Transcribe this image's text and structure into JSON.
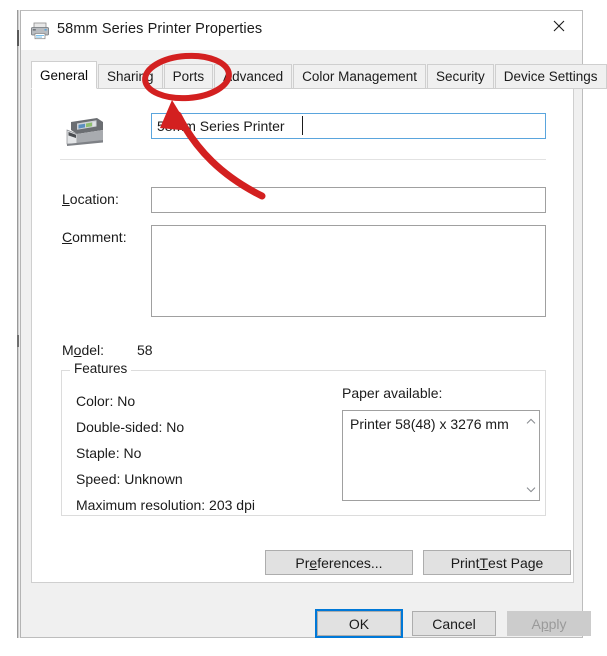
{
  "window": {
    "title": "58mm Series Printer Properties",
    "title_icon": "printer-icon",
    "close_icon": "close-icon"
  },
  "tabs": [
    {
      "label": "General",
      "active": true
    },
    {
      "label": "Sharing",
      "active": false
    },
    {
      "label": "Ports",
      "active": false
    },
    {
      "label": "Advanced",
      "active": false
    },
    {
      "label": "Color Management",
      "active": false
    },
    {
      "label": "Security",
      "active": false
    },
    {
      "label": "Device Settings",
      "active": false
    }
  ],
  "general": {
    "device_icon": "printer-device-icon",
    "name_value": "58mm Series Printer",
    "name_placeholder": "",
    "location_label_pre": "",
    "location_label_mnemonic": "L",
    "location_label_post": "ocation:",
    "location_value": "",
    "location_placeholder": "",
    "comment_label_mnemonic": "C",
    "comment_label_post": "omment:",
    "comment_value": "",
    "comment_placeholder": "",
    "model_label_pre": "M",
    "model_label_mnemonic": "o",
    "model_label_post": "del:",
    "model_value": "58",
    "features_group_title": "Features",
    "features": [
      "Color: No",
      "Double-sided: No",
      "Staple: No",
      "Speed: Unknown",
      "Maximum resolution: 203 dpi"
    ],
    "paper_available_label": "Paper available:",
    "paper_items": [
      "Printer 58(48) x 3276 mm"
    ],
    "scroll_up_icon": "chevron-up-icon",
    "scroll_down_icon": "chevron-down-icon",
    "preferences_pre": "Pr",
    "preferences_mnemonic": "e",
    "preferences_post": "ferences...",
    "print_test_pre": "Print ",
    "print_test_mnemonic": "T",
    "print_test_post": "est Page"
  },
  "footer": {
    "ok_label": "OK",
    "cancel_label": "Cancel",
    "apply_pre": "A",
    "apply_mnemonic": "p",
    "apply_post": "ply",
    "apply_disabled": true
  },
  "annotation": {
    "ellipse_target": "Ports",
    "arrow_target": "Ports",
    "color": "#d32020"
  }
}
